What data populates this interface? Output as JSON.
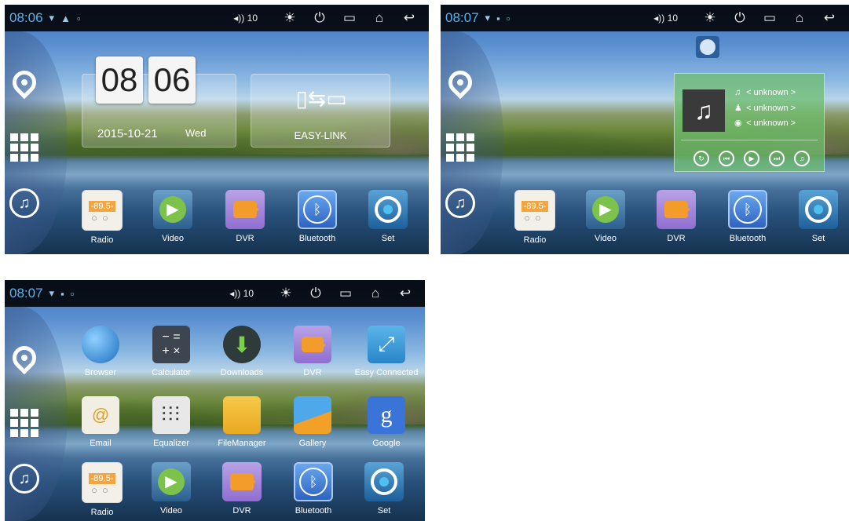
{
  "status": {
    "time1": "08:06",
    "time2": "08:07",
    "time3": "08:07",
    "volume": "10"
  },
  "home": {
    "clock_hour": "08",
    "clock_minute": "06",
    "date": "2015-10-21",
    "weekday": "Wed",
    "easylink_label": "EASY-LINK"
  },
  "music": {
    "title": "< unknown >",
    "artist": "< unknown >",
    "album": "< unknown >"
  },
  "dock": {
    "radio": "Radio",
    "radio_freq": "-89.5-",
    "video": "Video",
    "dvr": "DVR",
    "bluetooth": "Bluetooth",
    "set": "Set"
  },
  "apps": {
    "browser": "Browser",
    "calculator": "Calculator",
    "downloads": "Downloads",
    "dvr": "DVR",
    "easy_connected": "Easy Connected",
    "email": "Email",
    "equalizer": "Equalizer",
    "filemanager": "FileManager",
    "gallery": "Gallery",
    "google": "Google"
  },
  "colors": {
    "accent": "#56b4f3",
    "card": "#6ebe6e"
  },
  "icons": [
    "wifi-icon",
    "home-icon",
    "volume-icon",
    "brightness-icon",
    "power-icon",
    "recent-apps-icon",
    "home-button-icon",
    "back-icon",
    "location-icon",
    "apps-grid-icon",
    "music-icon"
  ]
}
